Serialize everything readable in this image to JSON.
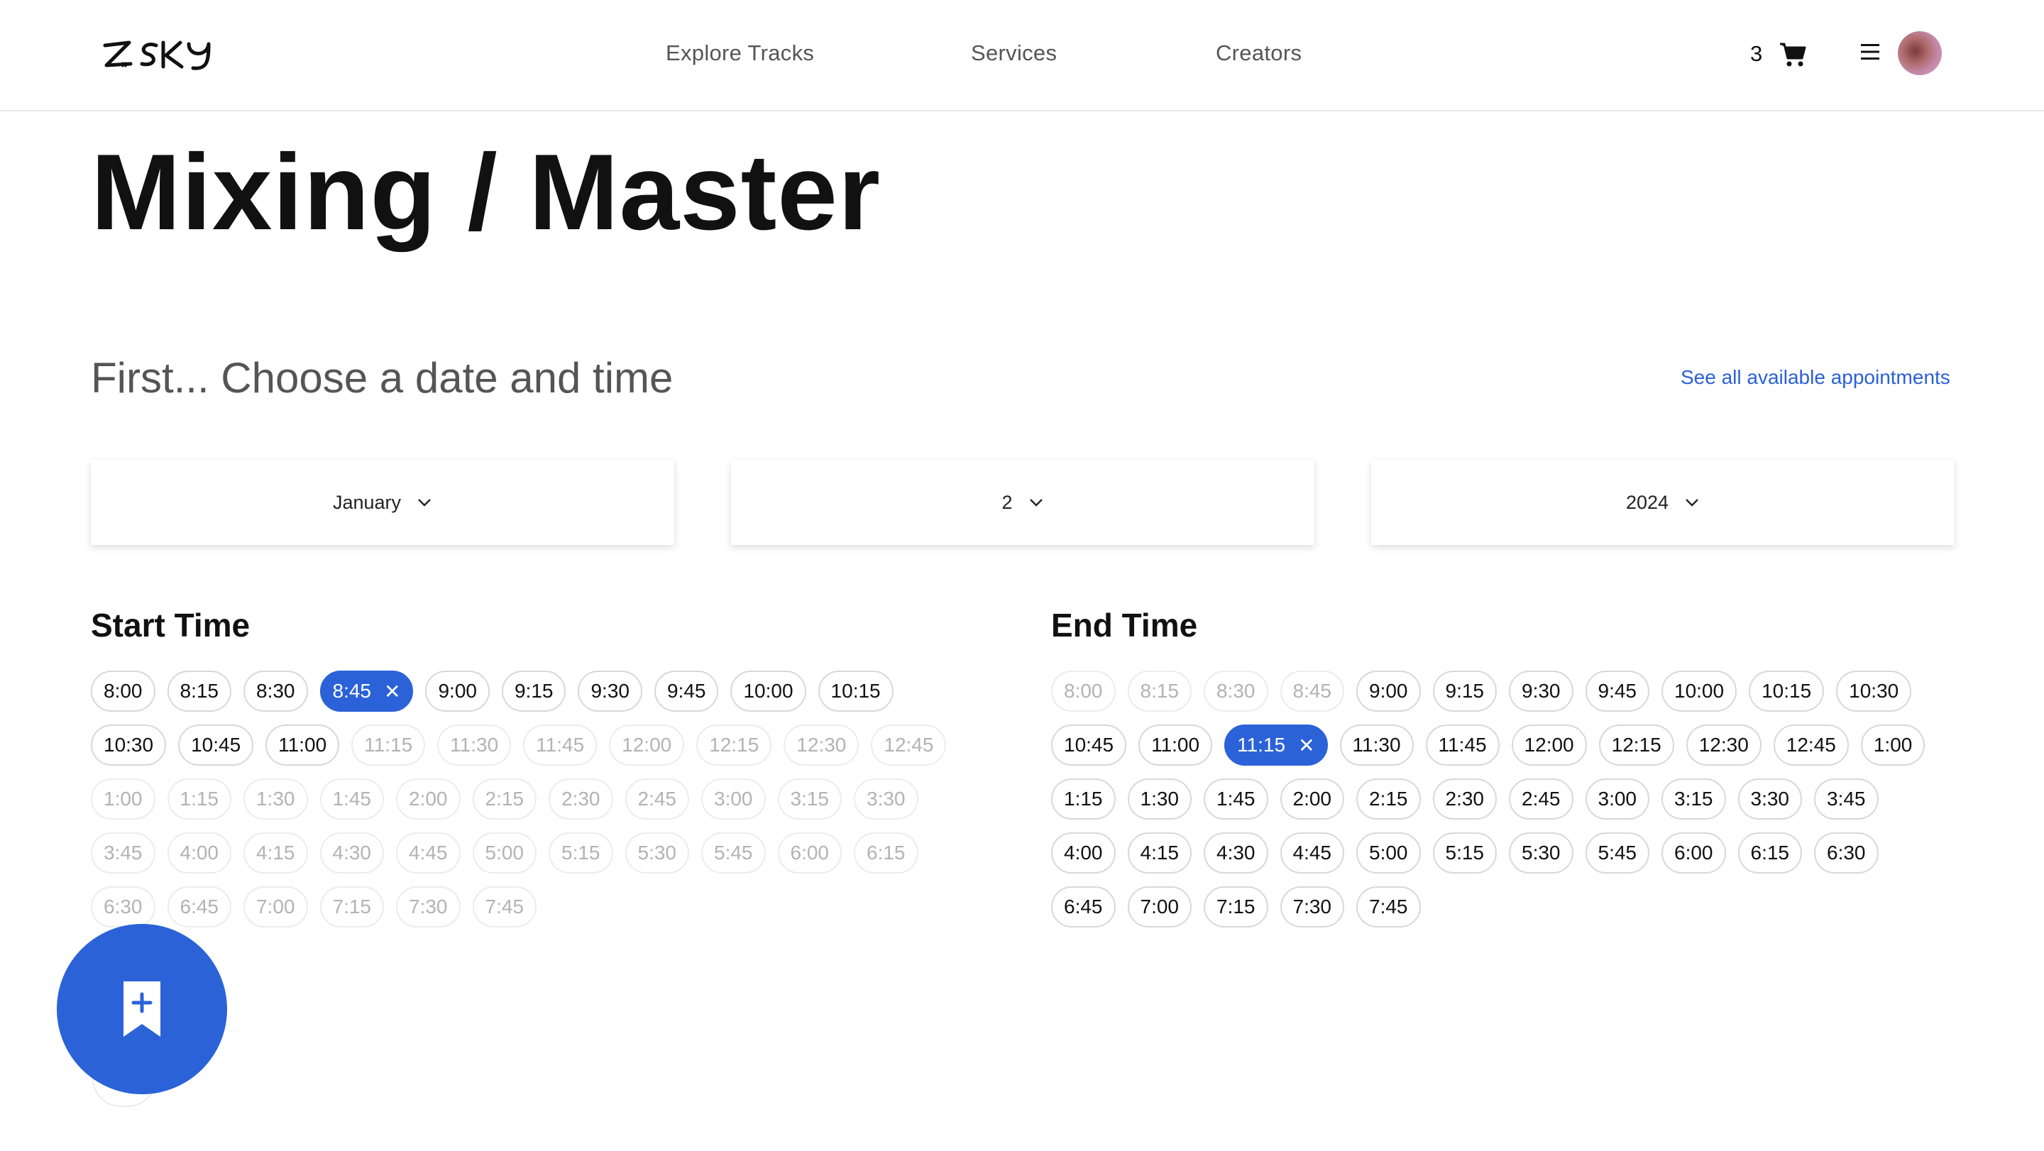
{
  "header": {
    "logo_text": "ZSKY",
    "nav": [
      "Explore Tracks",
      "Services",
      "Creators"
    ],
    "cart_count": "3",
    "icons": {
      "cart": "cart-icon",
      "menu": "menu-icon",
      "avatar": "avatar"
    }
  },
  "page": {
    "title": "Mixing / Master",
    "section_heading": "First... Choose a date and time",
    "see_all_link": "See all available appointments"
  },
  "date": {
    "month": "January",
    "day": "2",
    "year": "2024"
  },
  "start_time": {
    "heading": "Start Time",
    "selected": "8:45",
    "slots": [
      {
        "label": "8:00",
        "state": "available"
      },
      {
        "label": "8:15",
        "state": "available"
      },
      {
        "label": "8:30",
        "state": "available"
      },
      {
        "label": "8:45",
        "state": "selected"
      },
      {
        "label": "9:00",
        "state": "available"
      },
      {
        "label": "9:15",
        "state": "available"
      },
      {
        "label": "9:30",
        "state": "available"
      },
      {
        "label": "9:45",
        "state": "available"
      },
      {
        "label": "10:00",
        "state": "available"
      },
      {
        "label": "10:15",
        "state": "available"
      },
      {
        "label": "10:30",
        "state": "available"
      },
      {
        "label": "10:45",
        "state": "available"
      },
      {
        "label": "11:00",
        "state": "available"
      },
      {
        "label": "11:15",
        "state": "disabled"
      },
      {
        "label": "11:30",
        "state": "disabled"
      },
      {
        "label": "11:45",
        "state": "disabled"
      },
      {
        "label": "12:00",
        "state": "disabled"
      },
      {
        "label": "12:15",
        "state": "disabled"
      },
      {
        "label": "12:30",
        "state": "disabled"
      },
      {
        "label": "12:45",
        "state": "disabled"
      },
      {
        "label": "1:00",
        "state": "disabled"
      },
      {
        "label": "1:15",
        "state": "disabled"
      },
      {
        "label": "1:30",
        "state": "disabled"
      },
      {
        "label": "1:45",
        "state": "disabled"
      },
      {
        "label": "2:00",
        "state": "disabled"
      },
      {
        "label": "2:15",
        "state": "disabled"
      },
      {
        "label": "2:30",
        "state": "disabled"
      },
      {
        "label": "2:45",
        "state": "disabled"
      },
      {
        "label": "3:00",
        "state": "disabled"
      },
      {
        "label": "3:15",
        "state": "disabled"
      },
      {
        "label": "3:30",
        "state": "disabled"
      },
      {
        "label": "3:45",
        "state": "disabled"
      },
      {
        "label": "4:00",
        "state": "disabled"
      },
      {
        "label": "4:15",
        "state": "disabled"
      },
      {
        "label": "4:30",
        "state": "disabled"
      },
      {
        "label": "4:45",
        "state": "disabled"
      },
      {
        "label": "5:00",
        "state": "disabled"
      },
      {
        "label": "5:15",
        "state": "disabled"
      },
      {
        "label": "5:30",
        "state": "disabled"
      },
      {
        "label": "5:45",
        "state": "disabled"
      },
      {
        "label": "6:00",
        "state": "disabled"
      },
      {
        "label": "6:15",
        "state": "disabled"
      },
      {
        "label": "6:30",
        "state": "disabled"
      },
      {
        "label": "6:45",
        "state": "disabled"
      },
      {
        "label": "7:00",
        "state": "disabled"
      },
      {
        "label": "7:15",
        "state": "disabled"
      },
      {
        "label": "7:30",
        "state": "disabled"
      },
      {
        "label": "7:45",
        "state": "disabled"
      }
    ]
  },
  "end_time": {
    "heading": "End Time",
    "selected": "11:15",
    "slots": [
      {
        "label": "8:00",
        "state": "disabled"
      },
      {
        "label": "8:15",
        "state": "disabled"
      },
      {
        "label": "8:30",
        "state": "disabled"
      },
      {
        "label": "8:45",
        "state": "disabled"
      },
      {
        "label": "9:00",
        "state": "available"
      },
      {
        "label": "9:15",
        "state": "available"
      },
      {
        "label": "9:30",
        "state": "available"
      },
      {
        "label": "9:45",
        "state": "available"
      },
      {
        "label": "10:00",
        "state": "available"
      },
      {
        "label": "10:15",
        "state": "available"
      },
      {
        "label": "10:30",
        "state": "available"
      },
      {
        "label": "10:45",
        "state": "available"
      },
      {
        "label": "11:00",
        "state": "available"
      },
      {
        "label": "11:15",
        "state": "selected"
      },
      {
        "label": "11:30",
        "state": "available"
      },
      {
        "label": "11:45",
        "state": "available"
      },
      {
        "label": "12:00",
        "state": "available"
      },
      {
        "label": "12:15",
        "state": "available"
      },
      {
        "label": "12:30",
        "state": "available"
      },
      {
        "label": "12:45",
        "state": "available"
      },
      {
        "label": "1:00",
        "state": "available"
      },
      {
        "label": "1:15",
        "state": "available"
      },
      {
        "label": "1:30",
        "state": "available"
      },
      {
        "label": "1:45",
        "state": "available"
      },
      {
        "label": "2:00",
        "state": "available"
      },
      {
        "label": "2:15",
        "state": "available"
      },
      {
        "label": "2:30",
        "state": "available"
      },
      {
        "label": "2:45",
        "state": "available"
      },
      {
        "label": "3:00",
        "state": "available"
      },
      {
        "label": "3:15",
        "state": "available"
      },
      {
        "label": "3:30",
        "state": "available"
      },
      {
        "label": "3:45",
        "state": "available"
      },
      {
        "label": "4:00",
        "state": "available"
      },
      {
        "label": "4:15",
        "state": "available"
      },
      {
        "label": "4:30",
        "state": "available"
      },
      {
        "label": "4:45",
        "state": "available"
      },
      {
        "label": "5:00",
        "state": "available"
      },
      {
        "label": "5:15",
        "state": "available"
      },
      {
        "label": "5:30",
        "state": "available"
      },
      {
        "label": "5:45",
        "state": "available"
      },
      {
        "label": "6:00",
        "state": "available"
      },
      {
        "label": "6:15",
        "state": "available"
      },
      {
        "label": "6:30",
        "state": "available"
      },
      {
        "label": "6:45",
        "state": "available"
      },
      {
        "label": "7:00",
        "state": "available"
      },
      {
        "label": "7:15",
        "state": "available"
      },
      {
        "label": "7:30",
        "state": "available"
      },
      {
        "label": "7:45",
        "state": "available"
      }
    ]
  },
  "fab": {
    "icon": "bookmark-add-icon"
  },
  "colors": {
    "accent": "#2b62d8",
    "link": "#2b60d6"
  }
}
